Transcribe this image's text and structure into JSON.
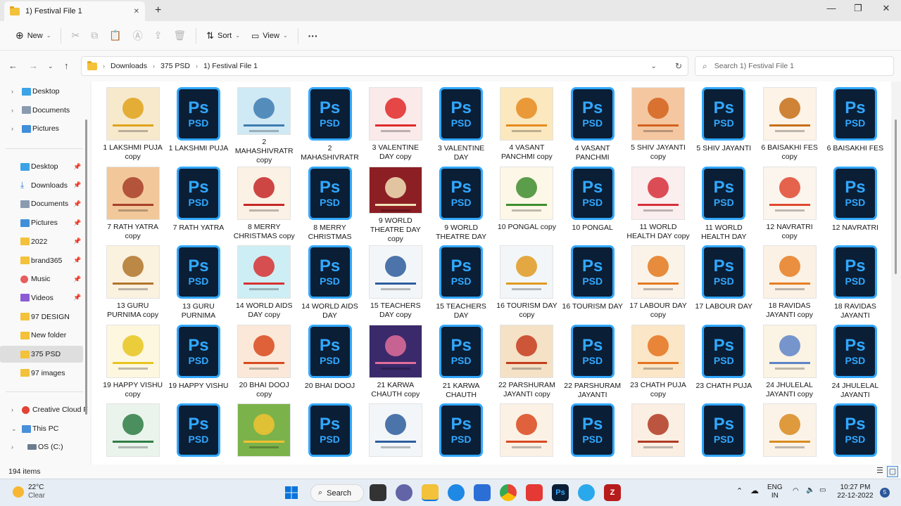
{
  "window": {
    "tab_title": "1) Festival File 1",
    "new_tab": "+",
    "minimize": "—",
    "maximize": "❐",
    "close": "✕",
    "tab_close": "✕"
  },
  "toolbar": {
    "new_label": "New",
    "sort_label": "Sort",
    "view_label": "View",
    "more_label": "···"
  },
  "address": {
    "crumbs": [
      "Downloads",
      "375 PSD",
      "1) Festival File 1"
    ],
    "search_placeholder": "Search 1) Festival File 1"
  },
  "sidebar": {
    "top": [
      {
        "label": "Desktop",
        "icon": "desktop-icon"
      },
      {
        "label": "Documents",
        "icon": "documents-icon"
      },
      {
        "label": "Pictures",
        "icon": "pictures-icon"
      }
    ],
    "quick": [
      {
        "label": "Desktop",
        "icon": "desktop-icon"
      },
      {
        "label": "Downloads",
        "icon": "download-icon"
      },
      {
        "label": "Documents",
        "icon": "documents-icon"
      },
      {
        "label": "Pictures",
        "icon": "pictures-icon"
      },
      {
        "label": "2022",
        "icon": "folder-icon"
      },
      {
        "label": "brand365",
        "icon": "folder-icon"
      },
      {
        "label": "Music",
        "icon": "music-icon"
      },
      {
        "label": "Videos",
        "icon": "videos-icon"
      },
      {
        "label": "97 DESIGN",
        "icon": "folder-icon"
      },
      {
        "label": "New folder",
        "icon": "folder-icon"
      },
      {
        "label": "375 PSD",
        "icon": "folder-icon"
      },
      {
        "label": "97 images",
        "icon": "folder-icon"
      }
    ],
    "bottom": [
      {
        "label": "Creative Cloud F",
        "icon": "creative-cloud-icon"
      },
      {
        "label": "This PC",
        "icon": "pc-icon"
      },
      {
        "label": "OS (C:)",
        "icon": "drive-icon"
      }
    ]
  },
  "files": [
    {
      "name": "1 LAKSHMI PUJA copy",
      "type": "img",
      "color": "#f6e9cc",
      "accent": "#e0a21b"
    },
    {
      "name": "1 LAKSHMI PUJA",
      "type": "psd"
    },
    {
      "name": "2 MAHASHIVRATR copy",
      "type": "img",
      "color": "#cfe9f5",
      "accent": "#3e7cb1"
    },
    {
      "name": "2 MAHASHIVRATR",
      "type": "psd"
    },
    {
      "name": "3 VALENTINE DAY copy",
      "type": "img",
      "color": "#fbeaea",
      "accent": "#e02929"
    },
    {
      "name": "3 VALENTINE DAY",
      "type": "psd"
    },
    {
      "name": "4 VASANT PANCHMI copy",
      "type": "img",
      "color": "#fbe8bf",
      "accent": "#e58b1f"
    },
    {
      "name": "4 VASANT PANCHMI",
      "type": "psd"
    },
    {
      "name": "5 SHIV JAYANTI copy",
      "type": "img",
      "color": "#f4c7a0",
      "accent": "#d4611d"
    },
    {
      "name": "5 SHIV JAYANTI",
      "type": "psd"
    },
    {
      "name": "6 BAISAKHI FES copy",
      "type": "img",
      "color": "#fdf3e7",
      "accent": "#c76f17"
    },
    {
      "name": "6 BAISAKHI FES",
      "type": "psd"
    },
    {
      "name": "7 RATH YATRA copy",
      "type": "img",
      "color": "#f2c79a",
      "accent": "#a8402a"
    },
    {
      "name": "7 RATH YATRA",
      "type": "psd"
    },
    {
      "name": "8 MERRY CHRISTMAS copy",
      "type": "img",
      "color": "#fbf1e4",
      "accent": "#c62828"
    },
    {
      "name": "8 MERRY CHRISTMAS",
      "type": "psd"
    },
    {
      "name": "9 WORLD THEATRE DAY copy",
      "type": "img",
      "color": "#8c1f24",
      "accent": "#f1e2b6"
    },
    {
      "name": "9 WORLD THEATRE DAY",
      "type": "psd"
    },
    {
      "name": "10 PONGAL copy",
      "type": "img",
      "color": "#fdf7e7",
      "accent": "#3f8d2f"
    },
    {
      "name": "10 PONGAL",
      "type": "psd"
    },
    {
      "name": "11 WORLD HEALTH DAY copy",
      "type": "img",
      "color": "#fbeeee",
      "accent": "#d62f3a"
    },
    {
      "name": "11 WORLD HEALTH DAY",
      "type": "psd"
    },
    {
      "name": "12 NAVRATRI copy",
      "type": "img",
      "color": "#fbf5ee",
      "accent": "#e0492f"
    },
    {
      "name": "12 NAVRATRI",
      "type": "psd"
    },
    {
      "name": "13 GURU PURNIMA copy",
      "type": "img",
      "color": "#fbf1df",
      "accent": "#b0752b"
    },
    {
      "name": "13 GURU PURNIMA",
      "type": "psd"
    },
    {
      "name": "14 WORLD AIDS DAY copy",
      "type": "img",
      "color": "#cdeef4",
      "accent": "#d73131"
    },
    {
      "name": "14 WORLD AIDS DAY",
      "type": "psd"
    },
    {
      "name": "15  TEACHERS DAY copy",
      "type": "img",
      "color": "#f3f6f9",
      "accent": "#2e5d9e"
    },
    {
      "name": "15  TEACHERS DAY",
      "type": "psd"
    },
    {
      "name": "16 TOURISM DAY copy",
      "type": "img",
      "color": "#f2f6f8",
      "accent": "#e09a21"
    },
    {
      "name": "16 TOURISM DAY",
      "type": "psd"
    },
    {
      "name": "17 LABOUR DAY copy",
      "type": "img",
      "color": "#fbf3e8",
      "accent": "#e3781f"
    },
    {
      "name": "17 LABOUR DAY",
      "type": "psd"
    },
    {
      "name": "18 RAVIDAS JAYANTI copy",
      "type": "img",
      "color": "#fbf1e4",
      "accent": "#e67e22"
    },
    {
      "name": "18 RAVIDAS JAYANTI",
      "type": "psd"
    },
    {
      "name": "19 HAPPY VISHU copy",
      "type": "img",
      "color": "#fdf7e0",
      "accent": "#e8c51f"
    },
    {
      "name": "19 HAPPY VISHU",
      "type": "psd"
    },
    {
      "name": "20 BHAI DOOJ copy",
      "type": "img",
      "color": "#fbe8d8",
      "accent": "#d9491f"
    },
    {
      "name": "20 BHAI DOOJ",
      "type": "psd"
    },
    {
      "name": "21 KARWA CHAUTH copy",
      "type": "img",
      "color": "#3a2a6b",
      "accent": "#e06d9a"
    },
    {
      "name": "21 KARWA CHAUTH",
      "type": "psd"
    },
    {
      "name": "22 PARSHURAM JAYANTI copy",
      "type": "img",
      "color": "#f4e1c6",
      "accent": "#c43d1d"
    },
    {
      "name": "22 PARSHURAM JAYANTI",
      "type": "psd"
    },
    {
      "name": "23 CHATH PUJA copy",
      "type": "img",
      "color": "#fbe6c7",
      "accent": "#e5731f"
    },
    {
      "name": "23 CHATH PUJA",
      "type": "psd"
    },
    {
      "name": "24 JHULELAL JAYANTI copy",
      "type": "img",
      "color": "#fbf3e3",
      "accent": "#5e84c8"
    },
    {
      "name": "24 JHULELAL JAYANTI",
      "type": "psd"
    },
    {
      "name": "",
      "type": "img",
      "color": "#eaf3ec",
      "accent": "#2f7d45"
    },
    {
      "name": "",
      "type": "psd"
    },
    {
      "name": "",
      "type": "img",
      "color": "#7cb24a",
      "accent": "#f2c230"
    },
    {
      "name": "",
      "type": "psd"
    },
    {
      "name": "",
      "type": "img",
      "color": "#f2f6f9",
      "accent": "#2e5d9e"
    },
    {
      "name": "",
      "type": "psd"
    },
    {
      "name": "",
      "type": "img",
      "color": "#fbf1e4",
      "accent": "#d9491f"
    },
    {
      "name": "",
      "type": "psd"
    },
    {
      "name": "",
      "type": "img",
      "color": "#fbeee2",
      "accent": "#b03a22"
    },
    {
      "name": "",
      "type": "psd"
    },
    {
      "name": "",
      "type": "img",
      "color": "#fbf3e8",
      "accent": "#d88a1e"
    },
    {
      "name": "",
      "type": "psd"
    }
  ],
  "psd_icon": {
    "ps": "Ps",
    "label": "PSD"
  },
  "status": {
    "count": "194 items"
  },
  "taskbar": {
    "temp": "22°C",
    "cond": "Clear",
    "search": "Search",
    "lang1": "ENG",
    "lang2": "IN",
    "time": "10:27 PM",
    "date": "22-12-2022",
    "badge": "5"
  }
}
